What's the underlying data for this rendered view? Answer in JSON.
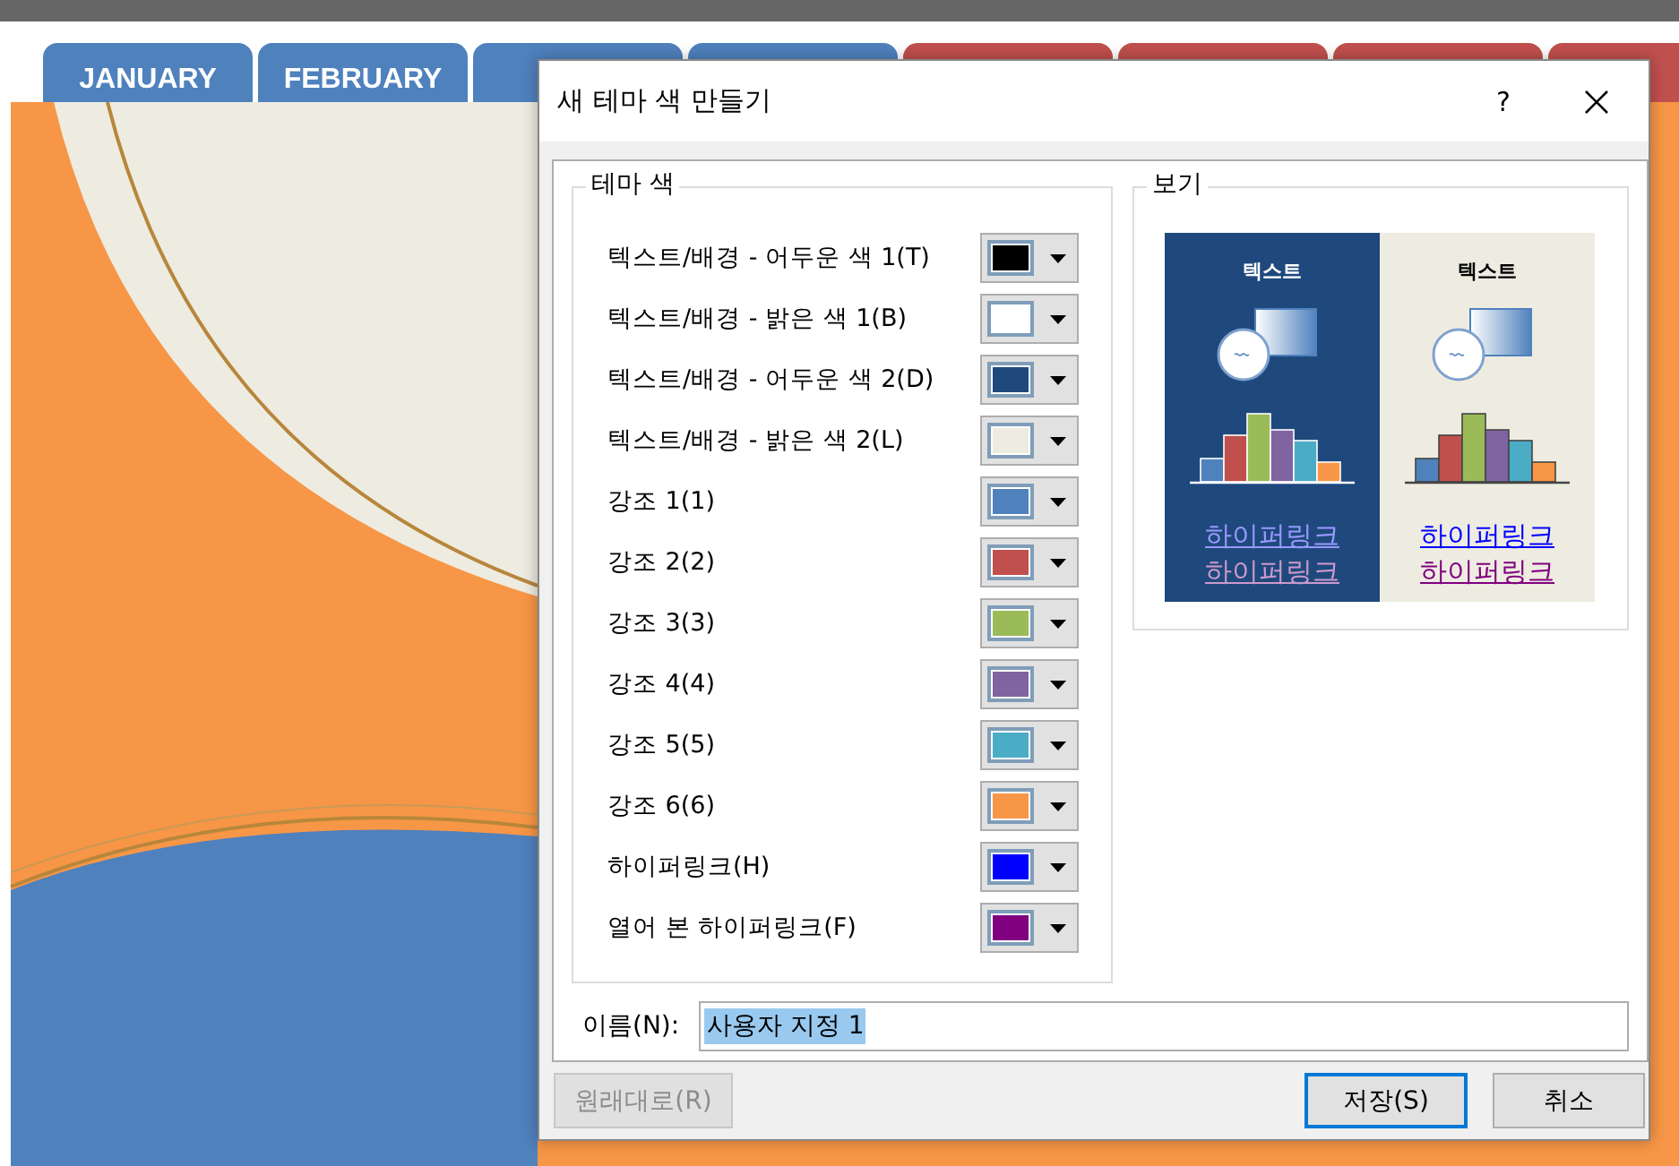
{
  "background_tabs": [
    {
      "label": "JANUARY",
      "color": "#4f81bd"
    },
    {
      "label": "FEBRUARY",
      "color": "#4f81bd"
    },
    {
      "color": "#4f81bd"
    },
    {
      "color": "#4f81bd"
    },
    {
      "color": "#c0504d"
    },
    {
      "color": "#c0504d"
    },
    {
      "color": "#c0504d"
    },
    {
      "color": "#c0504d"
    }
  ],
  "window": {
    "title": "새 테마 색 만들기",
    "help": "?"
  },
  "theme_colors": {
    "title": "테마 색",
    "items": [
      {
        "label": "텍스트/배경 - 어두운 색 1(T)",
        "color": "#000000"
      },
      {
        "label": "텍스트/배경 - 밝은 색 1(B)",
        "color": "#ffffff"
      },
      {
        "label": "텍스트/배경 - 어두운 색 2(D)",
        "color": "#1f497d"
      },
      {
        "label": "텍스트/배경 - 밝은 색 2(L)",
        "color": "#eeece1"
      },
      {
        "label": "강조 1(1)",
        "color": "#4f81bd"
      },
      {
        "label": "강조 2(2)",
        "color": "#c0504d"
      },
      {
        "label": "강조 3(3)",
        "color": "#9bbb59"
      },
      {
        "label": "강조 4(4)",
        "color": "#8064a2"
      },
      {
        "label": "강조 5(5)",
        "color": "#4bacc6"
      },
      {
        "label": "강조 6(6)",
        "color": "#f79646"
      },
      {
        "label": "하이퍼링크(H)",
        "color": "#0000ff"
      },
      {
        "label": "열어 본 하이퍼링크(F)",
        "color": "#800080"
      }
    ]
  },
  "preview": {
    "title": "보기",
    "panels": [
      {
        "heading": "텍스트",
        "links": [
          "하이퍼링크",
          "하이퍼링크"
        ]
      },
      {
        "heading": "텍스트",
        "links": [
          "하이퍼링크",
          "하이퍼링크"
        ]
      }
    ]
  },
  "name": {
    "label": "이름(N):",
    "value": "사용자 지정 1"
  },
  "buttons": [
    {
      "label": "원래대로(R)",
      "disabled": true,
      "focused": false
    },
    {
      "label": "저장(S)",
      "disabled": false,
      "focused": true
    },
    {
      "label": "취소",
      "disabled": false,
      "focused": false
    }
  ]
}
